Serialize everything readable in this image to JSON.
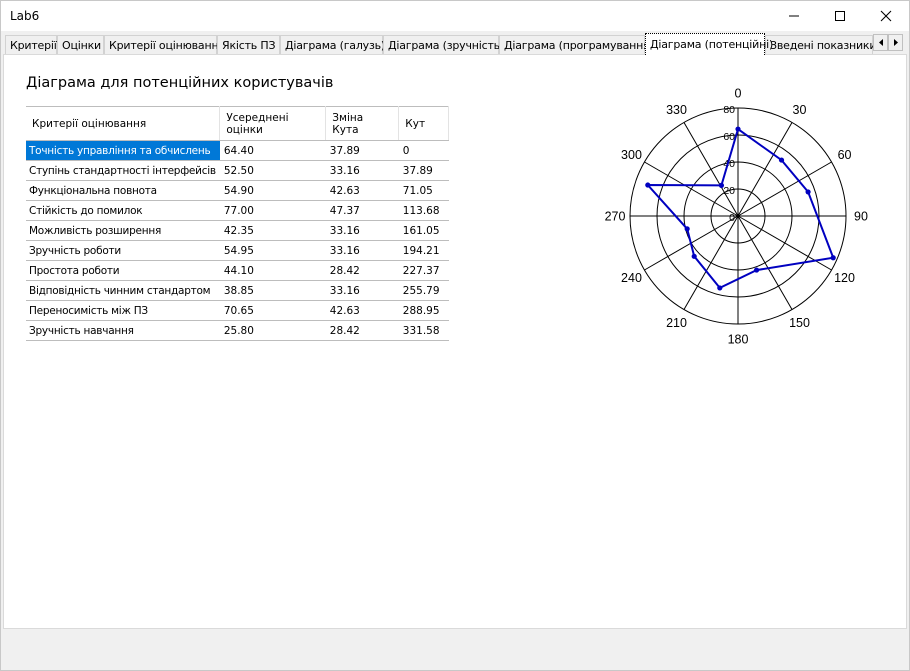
{
  "window": {
    "title": "Lab6"
  },
  "tabs": [
    {
      "label": "Критерії",
      "active": false
    },
    {
      "label": "Оцінки",
      "active": false
    },
    {
      "label": "Критерії оцінювання",
      "active": false
    },
    {
      "label": "Якість ПЗ",
      "active": false
    },
    {
      "label": "Діаграма (галузь)",
      "active": false
    },
    {
      "label": "Діаграма (зручність)",
      "active": false
    },
    {
      "label": "Діаграма (програмування)",
      "active": false
    },
    {
      "label": "Діаграма (потенційні)",
      "active": true
    },
    {
      "label": "Зведені показники",
      "active": false
    }
  ],
  "panel": {
    "heading": "Діаграма для потенційних користувачів"
  },
  "table": {
    "columns": [
      "Критерії оцінювання",
      "Усереднені оцінки",
      "Зміна Кута",
      "Кут"
    ],
    "selected_row": 0,
    "rows": [
      [
        "Точність управління та обчислень",
        "64.40",
        "37.89",
        "0"
      ],
      [
        "Ступінь стандартності інтерфейсів",
        "52.50",
        "33.16",
        "37.89"
      ],
      [
        "Функціональна повнота",
        "54.90",
        "42.63",
        "71.05"
      ],
      [
        "Стійкість до помилок",
        "77.00",
        "47.37",
        "113.68"
      ],
      [
        "Можливість розширення",
        "42.35",
        "33.16",
        "161.05"
      ],
      [
        "Зручність роботи",
        "54.95",
        "33.16",
        "194.21"
      ],
      [
        "Простота роботи",
        "44.10",
        "28.42",
        "227.37"
      ],
      [
        "Відповідність чинним стандартом",
        "38.85",
        "33.16",
        "255.79"
      ],
      [
        "Переносимість між ПЗ",
        "70.65",
        "42.63",
        "288.95"
      ],
      [
        "Зручність навчання",
        "25.80",
        "28.42",
        "331.58"
      ]
    ]
  },
  "chart_data": {
    "type": "polar",
    "radial_ticks": [
      "0",
      "20",
      "40",
      "60",
      "80"
    ],
    "radial_max": 80,
    "angle_labels": [
      "0",
      "30",
      "60",
      "90",
      "120",
      "150",
      "180",
      "210",
      "240",
      "270",
      "300",
      "330"
    ],
    "series": [
      {
        "color": "#0000c0",
        "points": [
          {
            "angle": 0,
            "r": 64.4
          },
          {
            "angle": 37.89,
            "r": 52.5
          },
          {
            "angle": 71.05,
            "r": 54.9
          },
          {
            "angle": 113.68,
            "r": 77.0
          },
          {
            "angle": 161.05,
            "r": 42.35
          },
          {
            "angle": 194.21,
            "r": 54.95
          },
          {
            "angle": 227.37,
            "r": 44.1
          },
          {
            "angle": 255.79,
            "r": 38.85
          },
          {
            "angle": 288.95,
            "r": 70.65
          },
          {
            "angle": 331.58,
            "r": 25.8
          }
        ]
      }
    ]
  },
  "colors": {
    "selection": "#0078d7",
    "series": "#0000c0"
  }
}
